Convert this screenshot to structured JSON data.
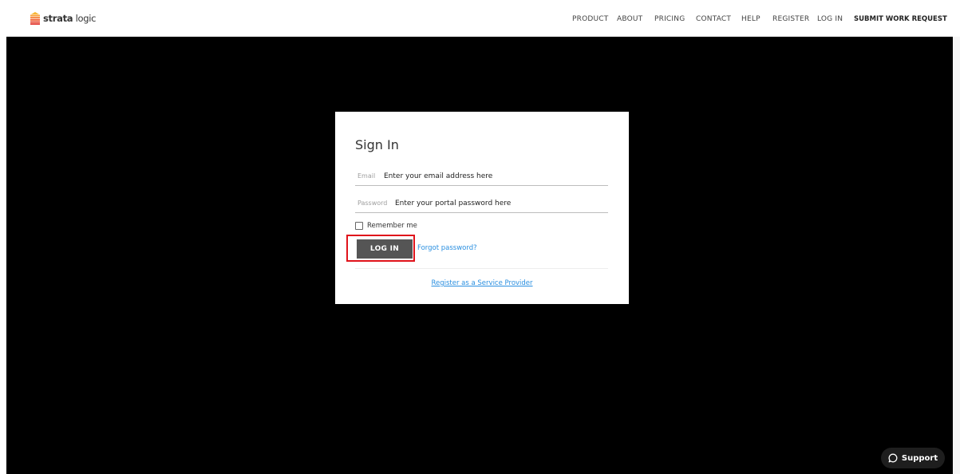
{
  "header": {
    "logo": {
      "brand": "strata",
      "suffix": " logic",
      "colors": [
        "#f7b733",
        "#f2693e",
        "#e2372f"
      ]
    },
    "nav": [
      "PRODUCT",
      "ABOUT",
      "PRICING",
      "CONTACT",
      "HELP",
      "REGISTER",
      "LOG IN",
      "SUBMIT WORK REQUEST"
    ]
  },
  "signin": {
    "title": "Sign In",
    "email_label": "Email",
    "email_placeholder": "Enter your email address here",
    "password_label": "Password",
    "password_placeholder": "Enter your portal password here",
    "remember_label": "Remember me",
    "remember_checked": false,
    "login_label": "LOG IN",
    "forgot_label": "Forgot password?",
    "register_label": "Register as a Service Provider"
  },
  "support": {
    "label": "Support",
    "icon": "chat-bubble-icon"
  },
  "colors": {
    "background": "#000000",
    "button": "#555555",
    "link": "#2a8fe0",
    "highlight": "#e0131b"
  }
}
